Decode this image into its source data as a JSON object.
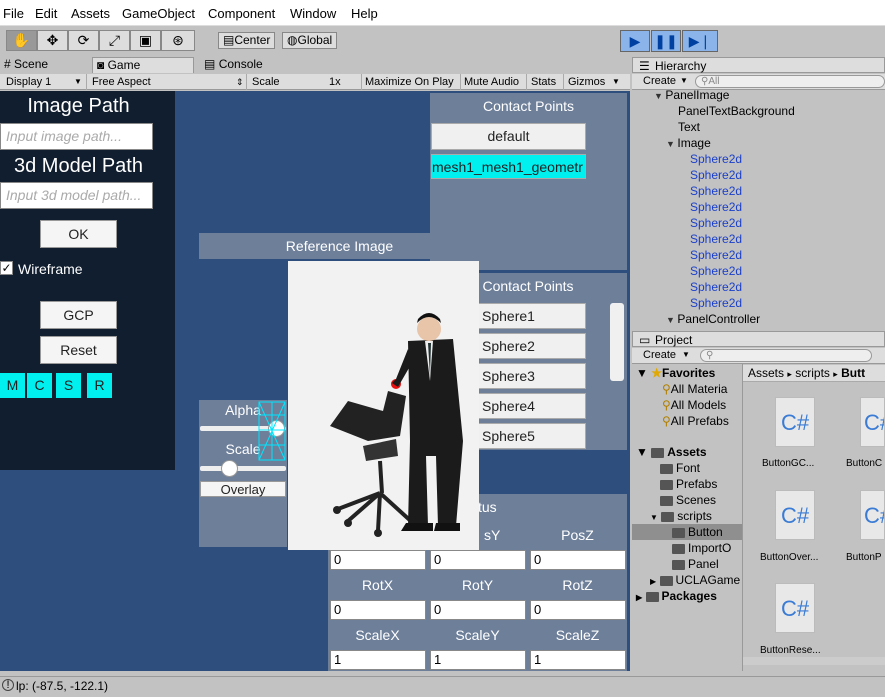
{
  "menu": [
    "File",
    "Edit",
    "Assets",
    "GameObject",
    "Component",
    "Window",
    "Help"
  ],
  "toolbar": {
    "center": "Center",
    "global": "Global"
  },
  "tabs": {
    "scene": "Scene",
    "game": "Game",
    "console": "Console",
    "hierarchy": "Hierarchy",
    "project": "Project"
  },
  "game_toolbar": {
    "display": "Display 1",
    "aspect": "Free Aspect",
    "scale_label": "Scale",
    "scale_value": "1x",
    "maximize": "Maximize On Play",
    "mute": "Mute Audio",
    "stats": "Stats",
    "gizmos": "Gizmos"
  },
  "left_panel": {
    "image_path_title": "Image Path",
    "image_path_placeholder": "Input image path...",
    "model_path_title": "3d Model Path",
    "model_path_placeholder": "Input 3d model path...",
    "ok": "OK",
    "wireframe": "Wireframe",
    "gcp": "GCP",
    "reset": "Reset",
    "mode_buttons": [
      "M",
      "C",
      "S",
      "R"
    ]
  },
  "contact_panel_top": {
    "title": "Contact Points",
    "default_btn": "default",
    "mesh_btn": "mesh1_mesh1_geometr"
  },
  "reference": {
    "title": "Reference Image"
  },
  "contact_panel_2": {
    "title": "Contact Points",
    "spheres": [
      "Sphere1",
      "Sphere2",
      "Sphere3",
      "Sphere4",
      "Sphere5"
    ]
  },
  "alpha_panel": {
    "alpha": "Alpha",
    "scale": "Scale",
    "overlay": "Overlay"
  },
  "transform": {
    "status_partial": "tus",
    "posy_partial": "sY",
    "posz": "PosZ",
    "rotx": "RotX",
    "roty": "RotY",
    "rotz": "RotZ",
    "scalex": "ScaleX",
    "scaley": "ScaleY",
    "scalez": "ScaleZ",
    "pos_values": [
      "0",
      "0",
      "0"
    ],
    "rot_values": [
      "0",
      "0",
      "0"
    ],
    "scale_values": [
      "1",
      "1",
      "1"
    ]
  },
  "hierarchy": {
    "create": "Create",
    "search": "All",
    "items": [
      {
        "label": "PanelImage",
        "indent": 0,
        "arrow": "▼",
        "blue": false
      },
      {
        "label": "PanelTextBackground",
        "indent": 1,
        "arrow": "",
        "blue": false
      },
      {
        "label": "Text",
        "indent": 1,
        "arrow": "",
        "blue": false
      },
      {
        "label": "Image",
        "indent": 1,
        "arrow": "▼",
        "blue": false
      },
      {
        "label": "Sphere2d",
        "indent": 2,
        "arrow": "",
        "blue": true
      },
      {
        "label": "Sphere2d",
        "indent": 2,
        "arrow": "",
        "blue": true
      },
      {
        "label": "Sphere2d",
        "indent": 2,
        "arrow": "",
        "blue": true
      },
      {
        "label": "Sphere2d",
        "indent": 2,
        "arrow": "",
        "blue": true
      },
      {
        "label": "Sphere2d",
        "indent": 2,
        "arrow": "",
        "blue": true
      },
      {
        "label": "Sphere2d",
        "indent": 2,
        "arrow": "",
        "blue": true
      },
      {
        "label": "Sphere2d",
        "indent": 2,
        "arrow": "",
        "blue": true
      },
      {
        "label": "Sphere2d",
        "indent": 2,
        "arrow": "",
        "blue": true
      },
      {
        "label": "Sphere2d",
        "indent": 2,
        "arrow": "",
        "blue": true
      },
      {
        "label": "Sphere2d",
        "indent": 2,
        "arrow": "",
        "blue": true
      },
      {
        "label": "PanelController",
        "indent": 1,
        "arrow": "▼",
        "blue": false
      }
    ]
  },
  "project": {
    "create": "Create",
    "breadcrumb": [
      "Assets",
      "scripts",
      "Butt"
    ],
    "favorites": "Favorites",
    "fav_items": [
      "All Materia",
      "All Models",
      "All Prefabs"
    ],
    "assets": "Assets",
    "folders": [
      "Font",
      "Prefabs",
      "Scenes",
      "scripts"
    ],
    "script_folders": [
      "Button",
      "ImportO",
      "Panel"
    ],
    "more_folders": [
      "UCLAGame"
    ],
    "packages": "Packages",
    "files": [
      "ButtonGC...",
      "ButtonC",
      "ButtonOver...",
      "ButtonP",
      "ButtonRese..."
    ]
  },
  "status": {
    "text": "lp: (-87.5, -122.1)"
  }
}
